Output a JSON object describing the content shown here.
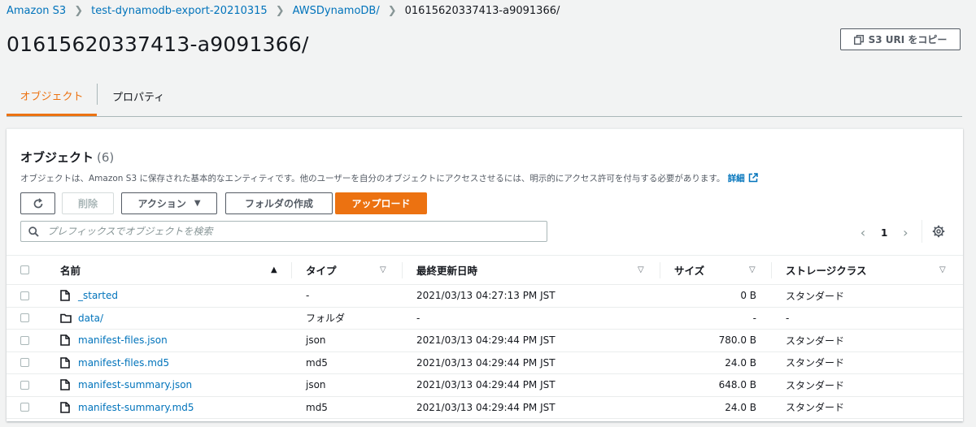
{
  "breadcrumb": {
    "items": [
      "Amazon S3",
      "test-dynamodb-export-20210315",
      "AWSDynamoDB/"
    ],
    "current": "01615620337413-a9091366/"
  },
  "page": {
    "title": "01615620337413-a9091366/",
    "copy_uri_label": "S3 URI をコピー"
  },
  "tabs": {
    "objects": "オブジェクト",
    "properties": "プロパティ"
  },
  "panel": {
    "title": "オブジェクト",
    "count": "(6)",
    "description": "オブジェクトは、Amazon S3 に保存された基本的なエンティティです。他のユーザーを自分のオブジェクトにアクセスさせるには、明示的にアクセス許可を付与する必要があります。",
    "details_link": "詳細"
  },
  "toolbar": {
    "delete_label": "削除",
    "actions_label": "アクション",
    "create_folder_label": "フォルダの作成",
    "upload_label": "アップロード"
  },
  "search": {
    "placeholder": "プレフィックスでオブジェクトを検索"
  },
  "pagination": {
    "current_page": "1"
  },
  "table": {
    "columns": [
      "名前",
      "タイプ",
      "最終更新日時",
      "サイズ",
      "ストレージクラス"
    ],
    "rows": [
      {
        "name": "_started",
        "icon": "file-icon",
        "type": "-",
        "modified": "2021/03/13 04:27:13 PM JST",
        "size": "0 B",
        "storage": "スタンダード"
      },
      {
        "name": "data/",
        "icon": "folder-icon",
        "type": "フォルダ",
        "modified": "-",
        "size": "-",
        "storage": "-"
      },
      {
        "name": "manifest-files.json",
        "icon": "file-icon",
        "type": "json",
        "modified": "2021/03/13 04:29:44 PM JST",
        "size": "780.0 B",
        "storage": "スタンダード"
      },
      {
        "name": "manifest-files.md5",
        "icon": "file-icon",
        "type": "md5",
        "modified": "2021/03/13 04:29:44 PM JST",
        "size": "24.0 B",
        "storage": "スタンダード"
      },
      {
        "name": "manifest-summary.json",
        "icon": "file-icon",
        "type": "json",
        "modified": "2021/03/13 04:29:44 PM JST",
        "size": "648.0 B",
        "storage": "スタンダード"
      },
      {
        "name": "manifest-summary.md5",
        "icon": "file-icon",
        "type": "md5",
        "modified": "2021/03/13 04:29:44 PM JST",
        "size": "24.0 B",
        "storage": "スタンダード"
      }
    ]
  },
  "colors": {
    "accent": "#ec7211",
    "link": "#0073bb"
  }
}
